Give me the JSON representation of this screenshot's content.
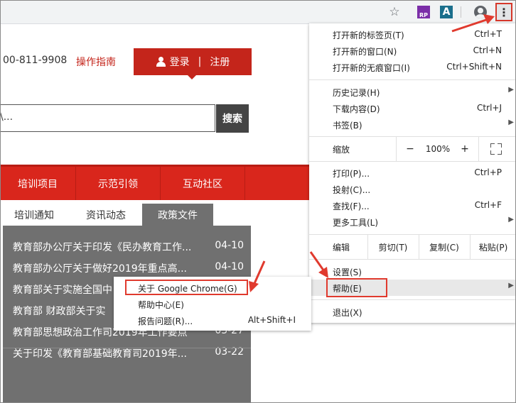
{
  "toolbar": {
    "bookmark_icon": "star-icon",
    "ext1_label": "RP",
    "ext2_label": "A",
    "menu_icon": "⋮"
  },
  "site": {
    "hotline": "00-811-9908",
    "guide": "操作指南",
    "login": "登录",
    "divider": "|",
    "register": "注册",
    "search_placeholder": "\\...",
    "search_button": "搜索",
    "nav": [
      "培训项目",
      "示范引领",
      "互动社区"
    ],
    "tabs": [
      "培训通知",
      "资讯动态",
      "政策文件"
    ],
    "active_tab": "政策文件",
    "news": [
      {
        "title": "教育部办公厅关于印发《民办教育工作...",
        "date": "04-10"
      },
      {
        "title": "教育部办公厅关于做好2019年重点高...",
        "date": "04-10"
      },
      {
        "title": "教育部关于实施全国中",
        "date": ""
      },
      {
        "title": "教育部 财政部关于实",
        "date": ""
      },
      {
        "title": "教育部思想政治工作司2019年工作要点",
        "date": "03-27"
      },
      {
        "title": "关于印发《教育部基础教育司2019年...",
        "date": "03-22"
      }
    ]
  },
  "chrome_menu": {
    "group1": [
      {
        "label": "打开新的标签页(T)",
        "shortcut": "Ctrl+T"
      },
      {
        "label": "打开新的窗口(N)",
        "shortcut": "Ctrl+N"
      },
      {
        "label": "打开新的无痕窗口(I)",
        "shortcut": "Ctrl+Shift+N"
      }
    ],
    "group2": [
      {
        "label": "历史记录(H)",
        "shortcut": ""
      },
      {
        "label": "下载内容(D)",
        "shortcut": "Ctrl+J"
      },
      {
        "label": "书签(B)",
        "shortcut": ""
      }
    ],
    "zoom": {
      "label": "缩放",
      "minus": "−",
      "value": "100%",
      "plus": "+"
    },
    "group3": [
      {
        "label": "打印(P)...",
        "shortcut": "Ctrl+P"
      },
      {
        "label": "投射(C)...",
        "shortcut": ""
      },
      {
        "label": "查找(F)...",
        "shortcut": "Ctrl+F"
      },
      {
        "label": "更多工具(L)",
        "shortcut": ""
      }
    ],
    "edit": {
      "label": "编辑",
      "cut": "剪切(T)",
      "copy": "复制(C)",
      "paste": "粘贴(P)"
    },
    "settings": "设置(S)",
    "help": "帮助(E)",
    "exit": "退出(X)",
    "submenu_arrow": "▶"
  },
  "help_submenu": [
    {
      "label": "关于 Google Chrome(G)",
      "shortcut": ""
    },
    {
      "label": "帮助中心(E)",
      "shortcut": ""
    },
    {
      "label": "报告问题(R)...",
      "shortcut": "Alt+Shift+I"
    }
  ],
  "colors": {
    "brand_red": "#d9261c",
    "highlight_box": "#e03a2e",
    "news_bg": "#707070"
  }
}
